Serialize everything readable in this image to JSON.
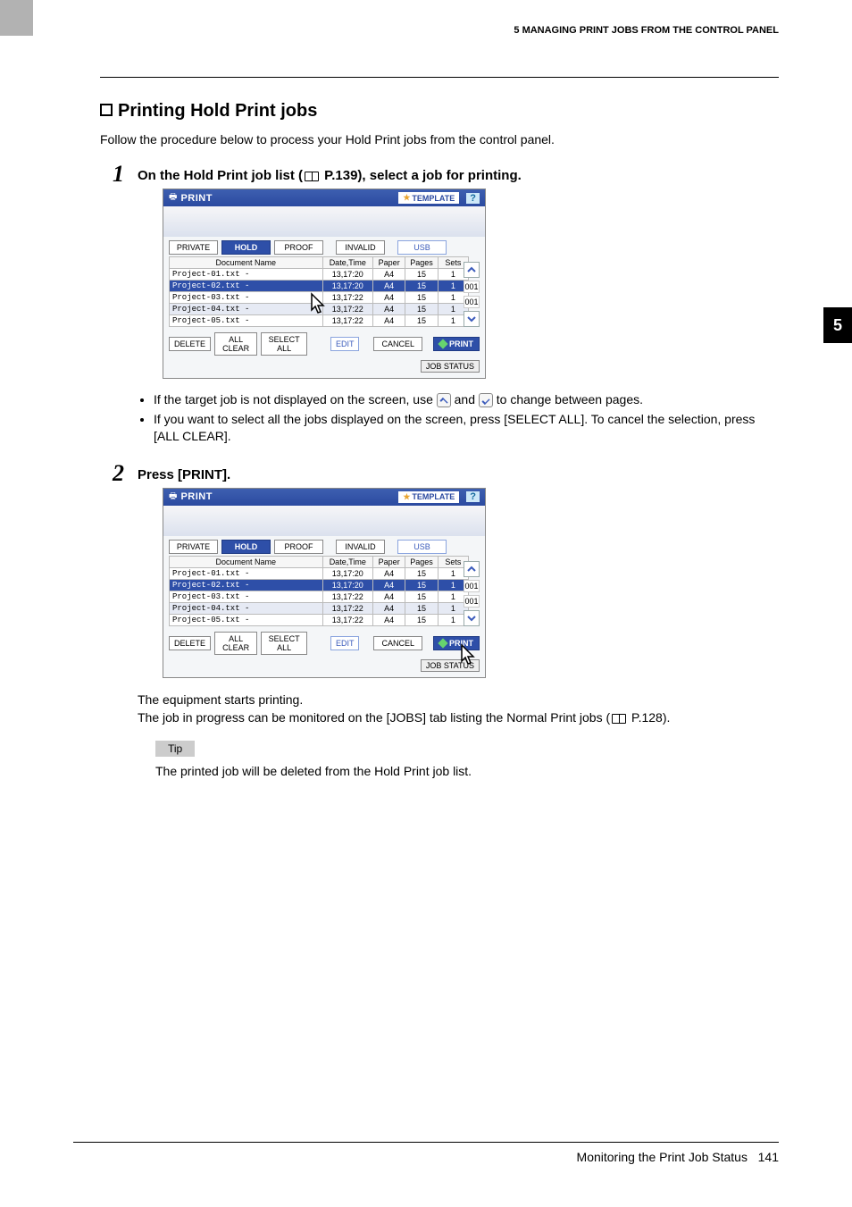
{
  "header": {
    "chapter": "5 MANAGING PRINT JOBS FROM THE CONTROL PANEL",
    "tab": "5"
  },
  "section": {
    "title": "Printing Hold Print jobs",
    "intro": "Follow the procedure below to process your Hold Print jobs from the control panel."
  },
  "step1": {
    "title_pre": "On the Hold Print job list (",
    "title_ref": " P.139), select a job for printing.",
    "bullet1_pre": "If the target job is not displayed on the screen, use ",
    "bullet1_mid": " and ",
    "bullet1_post": " to change between pages.",
    "bullet2": "If you want to select all the jobs displayed on the screen, press [SELECT ALL]. To cancel the selection, press [ALL CLEAR]."
  },
  "step2": {
    "title": "Press [PRINT].",
    "result1": "The equipment starts printing.",
    "result2_pre": "The job in progress can be monitored on the [JOBS] tab listing the Normal Print jobs (",
    "result2_ref": " P.128).",
    "tip_label": "Tip",
    "tip_text": "The printed job will be deleted from the Hold Print job list."
  },
  "panel": {
    "print_label": "PRINT",
    "template": "TEMPLATE",
    "help": "?",
    "tabs": {
      "private": "PRIVATE",
      "hold": "HOLD",
      "proof": "PROOF",
      "invalid": "INVALID",
      "usb": "USB"
    },
    "cols": {
      "doc": "Document Name",
      "dt": "Date,Time",
      "paper": "Paper",
      "pages": "Pages",
      "sets": "Sets"
    },
    "rows": [
      {
        "doc": "Project-01.txt -",
        "dt": "13,17:20",
        "paper": "A4",
        "pages": "15",
        "sets": "1"
      },
      {
        "doc": "Project-02.txt -",
        "dt": "13,17:20",
        "paper": "A4",
        "pages": "15",
        "sets": "1"
      },
      {
        "doc": "Project-03.txt -",
        "dt": "13,17:22",
        "paper": "A4",
        "pages": "15",
        "sets": "1"
      },
      {
        "doc": "Project-04.txt -",
        "dt": "13,17:22",
        "paper": "A4",
        "pages": "15",
        "sets": "1"
      },
      {
        "doc": "Project-05.txt -",
        "dt": "13,17:22",
        "paper": "A4",
        "pages": "15",
        "sets": "1"
      }
    ],
    "page_current": "001",
    "page_total": "001",
    "btns": {
      "delete": "DELETE",
      "allclear": "ALL CLEAR",
      "selectall": "SELECT ALL",
      "edit": "EDIT",
      "cancel": "CANCEL",
      "print": "PRINT",
      "jobstatus": "JOB STATUS"
    }
  },
  "footer": {
    "text": "Monitoring the Print Job Status",
    "page": "141"
  }
}
